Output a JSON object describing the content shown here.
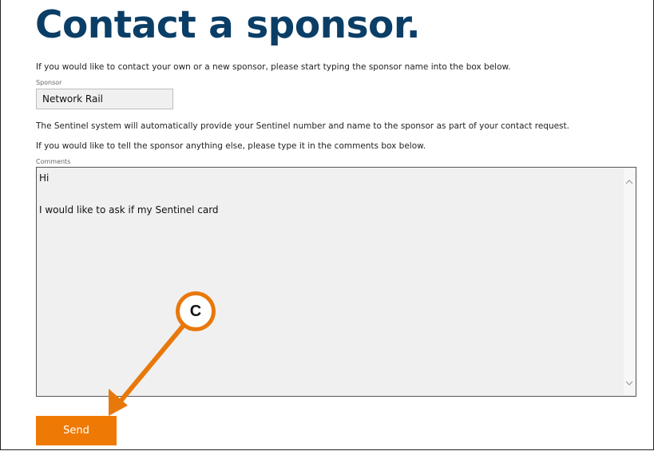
{
  "page": {
    "title": "Contact a sponsor.",
    "intro": "If you would like to contact your own or a new sponsor, please start typing the sponsor name into the box below.",
    "sponsor_label": "Sponsor",
    "sponsor_value": "Network Rail",
    "info_line": "The Sentinel system will automatically provide your Sentinel number and name to the sponsor as part of your contact request.",
    "comments_prompt": "If you would like to tell the sponsor anything else, please type it in the comments box below.",
    "comments_label": "Comments",
    "comments_lines": [
      "Hi",
      "",
      "I would like to ask if my Sentinel card"
    ],
    "send_label": "Send"
  },
  "annotation": {
    "marker_label": "C",
    "color": "#e8780a"
  },
  "colors": {
    "title": "#0b3e66",
    "button": "#ee7a05"
  }
}
